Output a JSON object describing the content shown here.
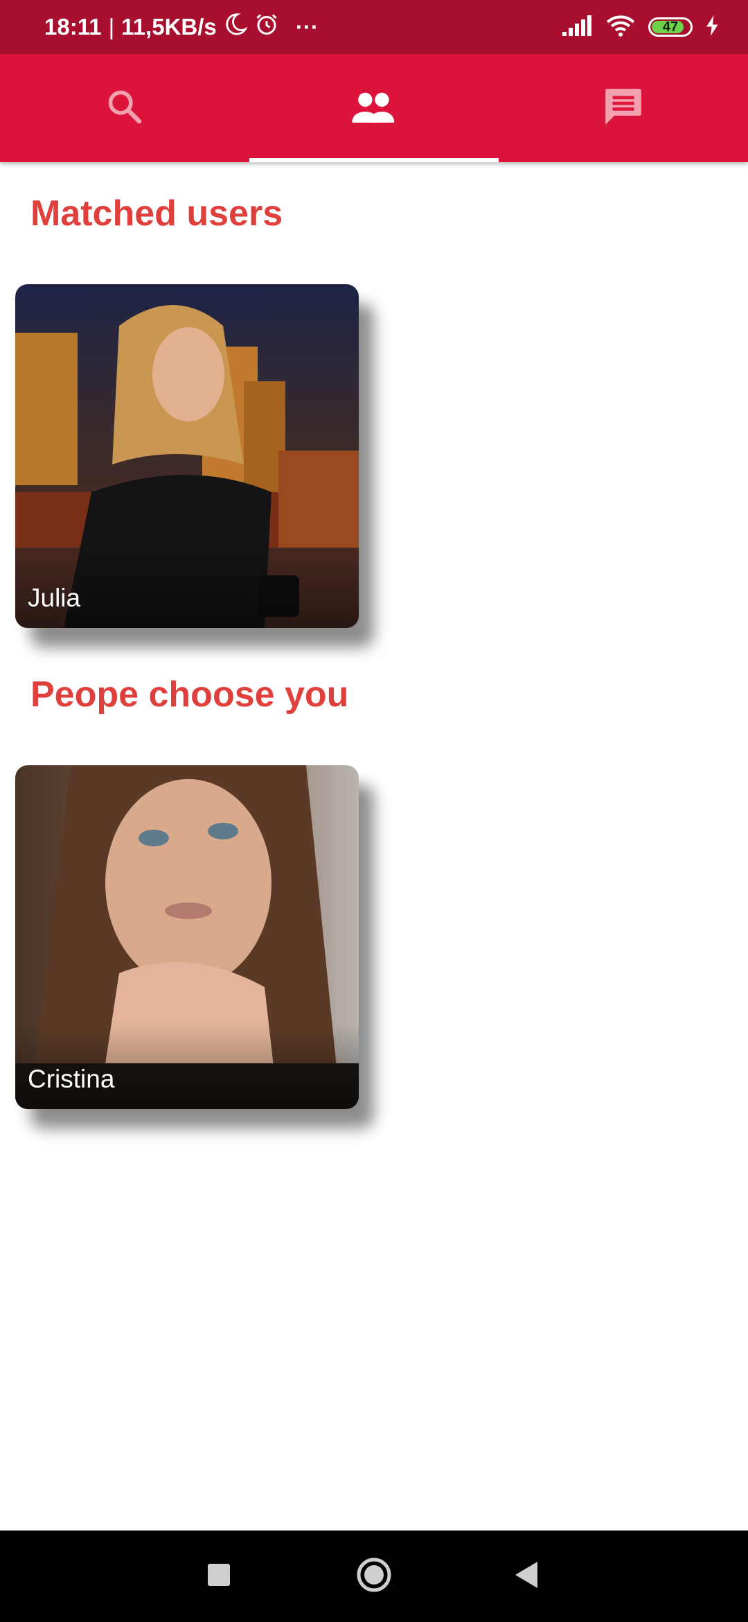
{
  "status_bar": {
    "time": "18:11",
    "separator": "|",
    "speed": "11,5KB/s",
    "more": "···",
    "battery_level": "47"
  },
  "tabs": [
    {
      "icon": "search-icon",
      "selected": false
    },
    {
      "icon": "people-icon",
      "selected": true
    },
    {
      "icon": "chat-icon",
      "selected": false
    }
  ],
  "sections": {
    "matched_title": "Matched users",
    "chosen_title": "Peope choose you"
  },
  "matched_users": [
    {
      "name": "Julia"
    }
  ],
  "chosen_users": [
    {
      "name": "Cristina"
    }
  ],
  "colors": {
    "status_bar": "#a80e2e",
    "tab_bar": "#dc143c",
    "section_title": "#e0403c",
    "battery_fill": "#6cd24a"
  },
  "nav": {
    "icons": [
      "recents-square-icon",
      "home-circle-icon",
      "back-triangle-icon"
    ]
  }
}
